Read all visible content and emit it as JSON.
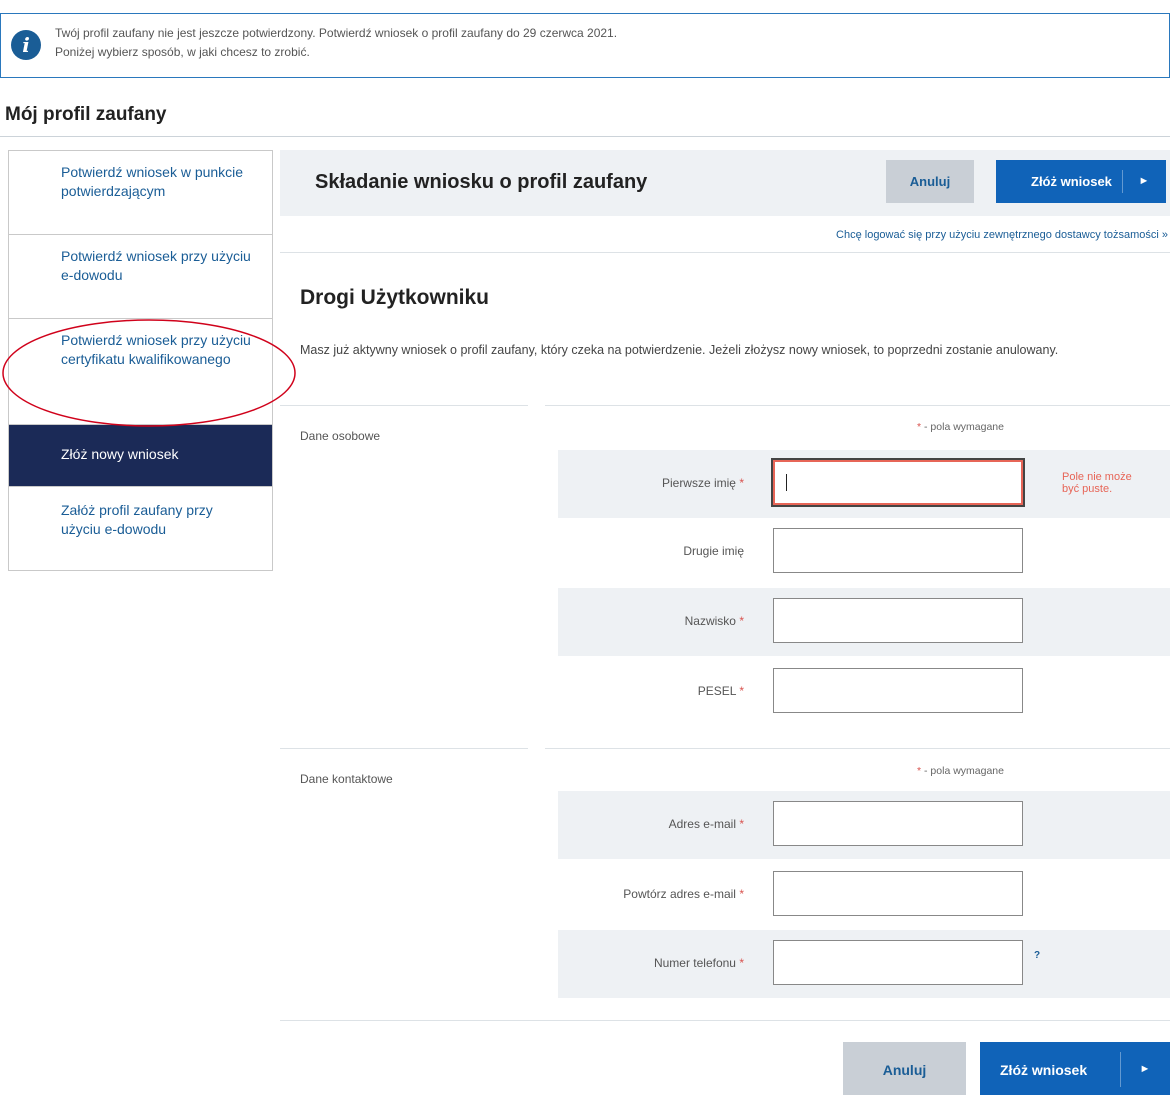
{
  "alert": {
    "line1": "Twój profil zaufany nie jest jeszcze potwierdzony. Potwierdź wniosek o profil zaufany do 29 czerwca 2021.",
    "line2": "Poniżej wybierz sposób, w jaki chcesz to zrobić."
  },
  "page_title": "Mój profil zaufany",
  "sidebar": {
    "items": [
      {
        "label": "Potwierdź wniosek w punkcie potwierdzającym"
      },
      {
        "label": "Potwierdź wniosek przy użyciu e-dowodu"
      },
      {
        "label": "Potwierdź wniosek przy użyciu certyfikatu kwalifikowanego"
      },
      {
        "label": "Złóż nowy wniosek",
        "active": true
      },
      {
        "label": "Załóż profil zaufany przy użyciu e-dowodu"
      }
    ]
  },
  "header": {
    "title": "Składanie wniosku o profil zaufany",
    "cancel": "Anuluj",
    "submit": "Złóż wniosek"
  },
  "external_link": "Chcę logować się przy użyciu zewnętrznego dostawcy tożsamości »",
  "greeting": "Drogi Użytkowniku",
  "notice": "Masz już aktywny wniosek o profil zaufany, który czeka na potwierdzenie. Jeżeli złożysz nowy wniosek, to poprzedni zostanie anulowany.",
  "required_note": "- pola wymagane",
  "personal": {
    "label": "Dane osobowe",
    "fields": [
      {
        "label": "Pierwsze imię",
        "required": true,
        "value": "",
        "error": "Pole nie może być puste."
      },
      {
        "label": "Drugie imię",
        "required": false,
        "value": ""
      },
      {
        "label": "Nazwisko",
        "required": true,
        "value": ""
      },
      {
        "label": "PESEL",
        "required": true,
        "value": ""
      }
    ]
  },
  "contact": {
    "label": "Dane kontaktowe",
    "fields": [
      {
        "label": "Adres e-mail",
        "required": true,
        "value": ""
      },
      {
        "label": "Powtórz adres e-mail",
        "required": true,
        "value": ""
      },
      {
        "label": "Numer telefonu",
        "required": true,
        "value": "",
        "help": "?"
      }
    ]
  },
  "footer": {
    "cancel": "Anuluj",
    "submit": "Złóż wniosek"
  },
  "colors": {
    "accent": "#1063b8",
    "nav_active": "#1b2a57",
    "error": "#e76557",
    "highlight_ellipse": "#d0021b"
  },
  "icons": {
    "alert": "info-icon",
    "submit_arrow": "arrow-right-icon"
  }
}
